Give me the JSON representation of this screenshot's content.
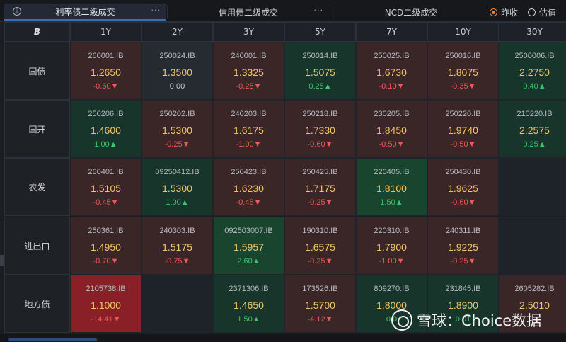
{
  "tabs": [
    {
      "label": "利率债二级成交",
      "more": "···",
      "active": true
    },
    {
      "label": "信用债二级成交",
      "more": "···",
      "active": false
    },
    {
      "label": "NCD二级成交",
      "more": "···",
      "active": false
    }
  ],
  "info_glyph": "i",
  "price_mode": {
    "options": [
      {
        "label": "昨收",
        "selected": true
      },
      {
        "label": "估值",
        "selected": false
      }
    ]
  },
  "corner_label": "B",
  "tenors": [
    "1Y",
    "2Y",
    "3Y",
    "5Y",
    "7Y",
    "10Y",
    "30Y"
  ],
  "rows": [
    {
      "label": "国债",
      "cells": [
        {
          "code": "260001.IB",
          "yield": "1.2650",
          "change": "-0.50▼",
          "tone": "red",
          "dir": "down"
        },
        {
          "code": "250024.IB",
          "yield": "1.3500",
          "change": "0.00",
          "tone": "neutral",
          "dir": "flat"
        },
        {
          "code": "240001.IB",
          "yield": "1.3325",
          "change": "-0.25▼",
          "tone": "red",
          "dir": "down"
        },
        {
          "code": "250014.IB",
          "yield": "1.5075",
          "change": "0.25▲",
          "tone": "green",
          "dir": "up"
        },
        {
          "code": "250025.IB",
          "yield": "1.6730",
          "change": "-0.10▼",
          "tone": "red",
          "dir": "down"
        },
        {
          "code": "250016.IB",
          "yield": "1.8075",
          "change": "-0.35▼",
          "tone": "red",
          "dir": "down"
        },
        {
          "code": "2500006.IB",
          "yield": "2.2750",
          "change": "0.40▲",
          "tone": "green",
          "dir": "up"
        }
      ]
    },
    {
      "label": "国开",
      "cells": [
        {
          "code": "250206.IB",
          "yield": "1.4600",
          "change": "1.00▲",
          "tone": "green",
          "dir": "up"
        },
        {
          "code": "250202.IB",
          "yield": "1.5300",
          "change": "-0.25▼",
          "tone": "red",
          "dir": "down"
        },
        {
          "code": "240203.IB",
          "yield": "1.6175",
          "change": "-1.00▼",
          "tone": "red",
          "dir": "down"
        },
        {
          "code": "250218.IB",
          "yield": "1.7330",
          "change": "-0.60▼",
          "tone": "red",
          "dir": "down"
        },
        {
          "code": "230205.IB",
          "yield": "1.8450",
          "change": "-0.50▼",
          "tone": "red",
          "dir": "down"
        },
        {
          "code": "250220.IB",
          "yield": "1.9740",
          "change": "-0.50▼",
          "tone": "red",
          "dir": "down"
        },
        {
          "code": "210220.IB",
          "yield": "2.2575",
          "change": "0.25▲",
          "tone": "green",
          "dir": "up"
        }
      ]
    },
    {
      "label": "农发",
      "cells": [
        {
          "code": "260401.IB",
          "yield": "1.5105",
          "change": "-0.45▼",
          "tone": "red",
          "dir": "down"
        },
        {
          "code": "09250412.IB",
          "yield": "1.5300",
          "change": "1.00▲",
          "tone": "green",
          "dir": "up"
        },
        {
          "code": "250423.IB",
          "yield": "1.6230",
          "change": "-0.45▼",
          "tone": "red",
          "dir": "down"
        },
        {
          "code": "250425.IB",
          "yield": "1.7175",
          "change": "-0.25▼",
          "tone": "red",
          "dir": "down"
        },
        {
          "code": "220405.IB",
          "yield": "1.8100",
          "change": "1.50▲",
          "tone": "strong-green",
          "dir": "up"
        },
        {
          "code": "250430.IB",
          "yield": "1.9625",
          "change": "-0.60▼",
          "tone": "red",
          "dir": "down"
        },
        {
          "code": "",
          "yield": "",
          "change": "",
          "tone": "empty",
          "dir": "flat"
        }
      ]
    },
    {
      "label": "进出口",
      "cells": [
        {
          "code": "250361.IB",
          "yield": "1.4950",
          "change": "-0.70▼",
          "tone": "red",
          "dir": "down"
        },
        {
          "code": "240303.IB",
          "yield": "1.5175",
          "change": "-0.75▼",
          "tone": "red",
          "dir": "down"
        },
        {
          "code": "092503007.IB",
          "yield": "1.5957",
          "change": "2.60▲",
          "tone": "strong-green",
          "dir": "up"
        },
        {
          "code": "190310.IB",
          "yield": "1.6575",
          "change": "-0.25▼",
          "tone": "red",
          "dir": "down"
        },
        {
          "code": "220310.IB",
          "yield": "1.7900",
          "change": "-1.00▼",
          "tone": "red",
          "dir": "down"
        },
        {
          "code": "240311.IB",
          "yield": "1.9225",
          "change": "-0.25▼",
          "tone": "red",
          "dir": "down"
        },
        {
          "code": "",
          "yield": "",
          "change": "",
          "tone": "empty",
          "dir": "flat"
        }
      ]
    },
    {
      "label": "地方债",
      "cells": [
        {
          "code": "2105738.IB",
          "yield": "1.1000",
          "change": "-14.41▼",
          "tone": "strong-red",
          "dir": "down"
        },
        {
          "code": "",
          "yield": "",
          "change": "",
          "tone": "empty",
          "dir": "flat"
        },
        {
          "code": "2371306.IB",
          "yield": "1.4650",
          "change": "1.50▲",
          "tone": "green",
          "dir": "up"
        },
        {
          "code": "173526.IB",
          "yield": "1.5700",
          "change": "-4.12▼",
          "tone": "red",
          "dir": "down"
        },
        {
          "code": "809270.IB",
          "yield": "1.8000",
          "change": "0.0",
          "tone": "green",
          "dir": "up"
        },
        {
          "code": "231845.IB",
          "yield": "1.8900",
          "change": "0.01",
          "tone": "green",
          "dir": "up"
        },
        {
          "code": "2605282.IB",
          "yield": "2.5010",
          "change": "",
          "tone": "red",
          "dir": "down"
        }
      ]
    }
  ],
  "watermark": {
    "text": "雪球：Choice数据"
  }
}
